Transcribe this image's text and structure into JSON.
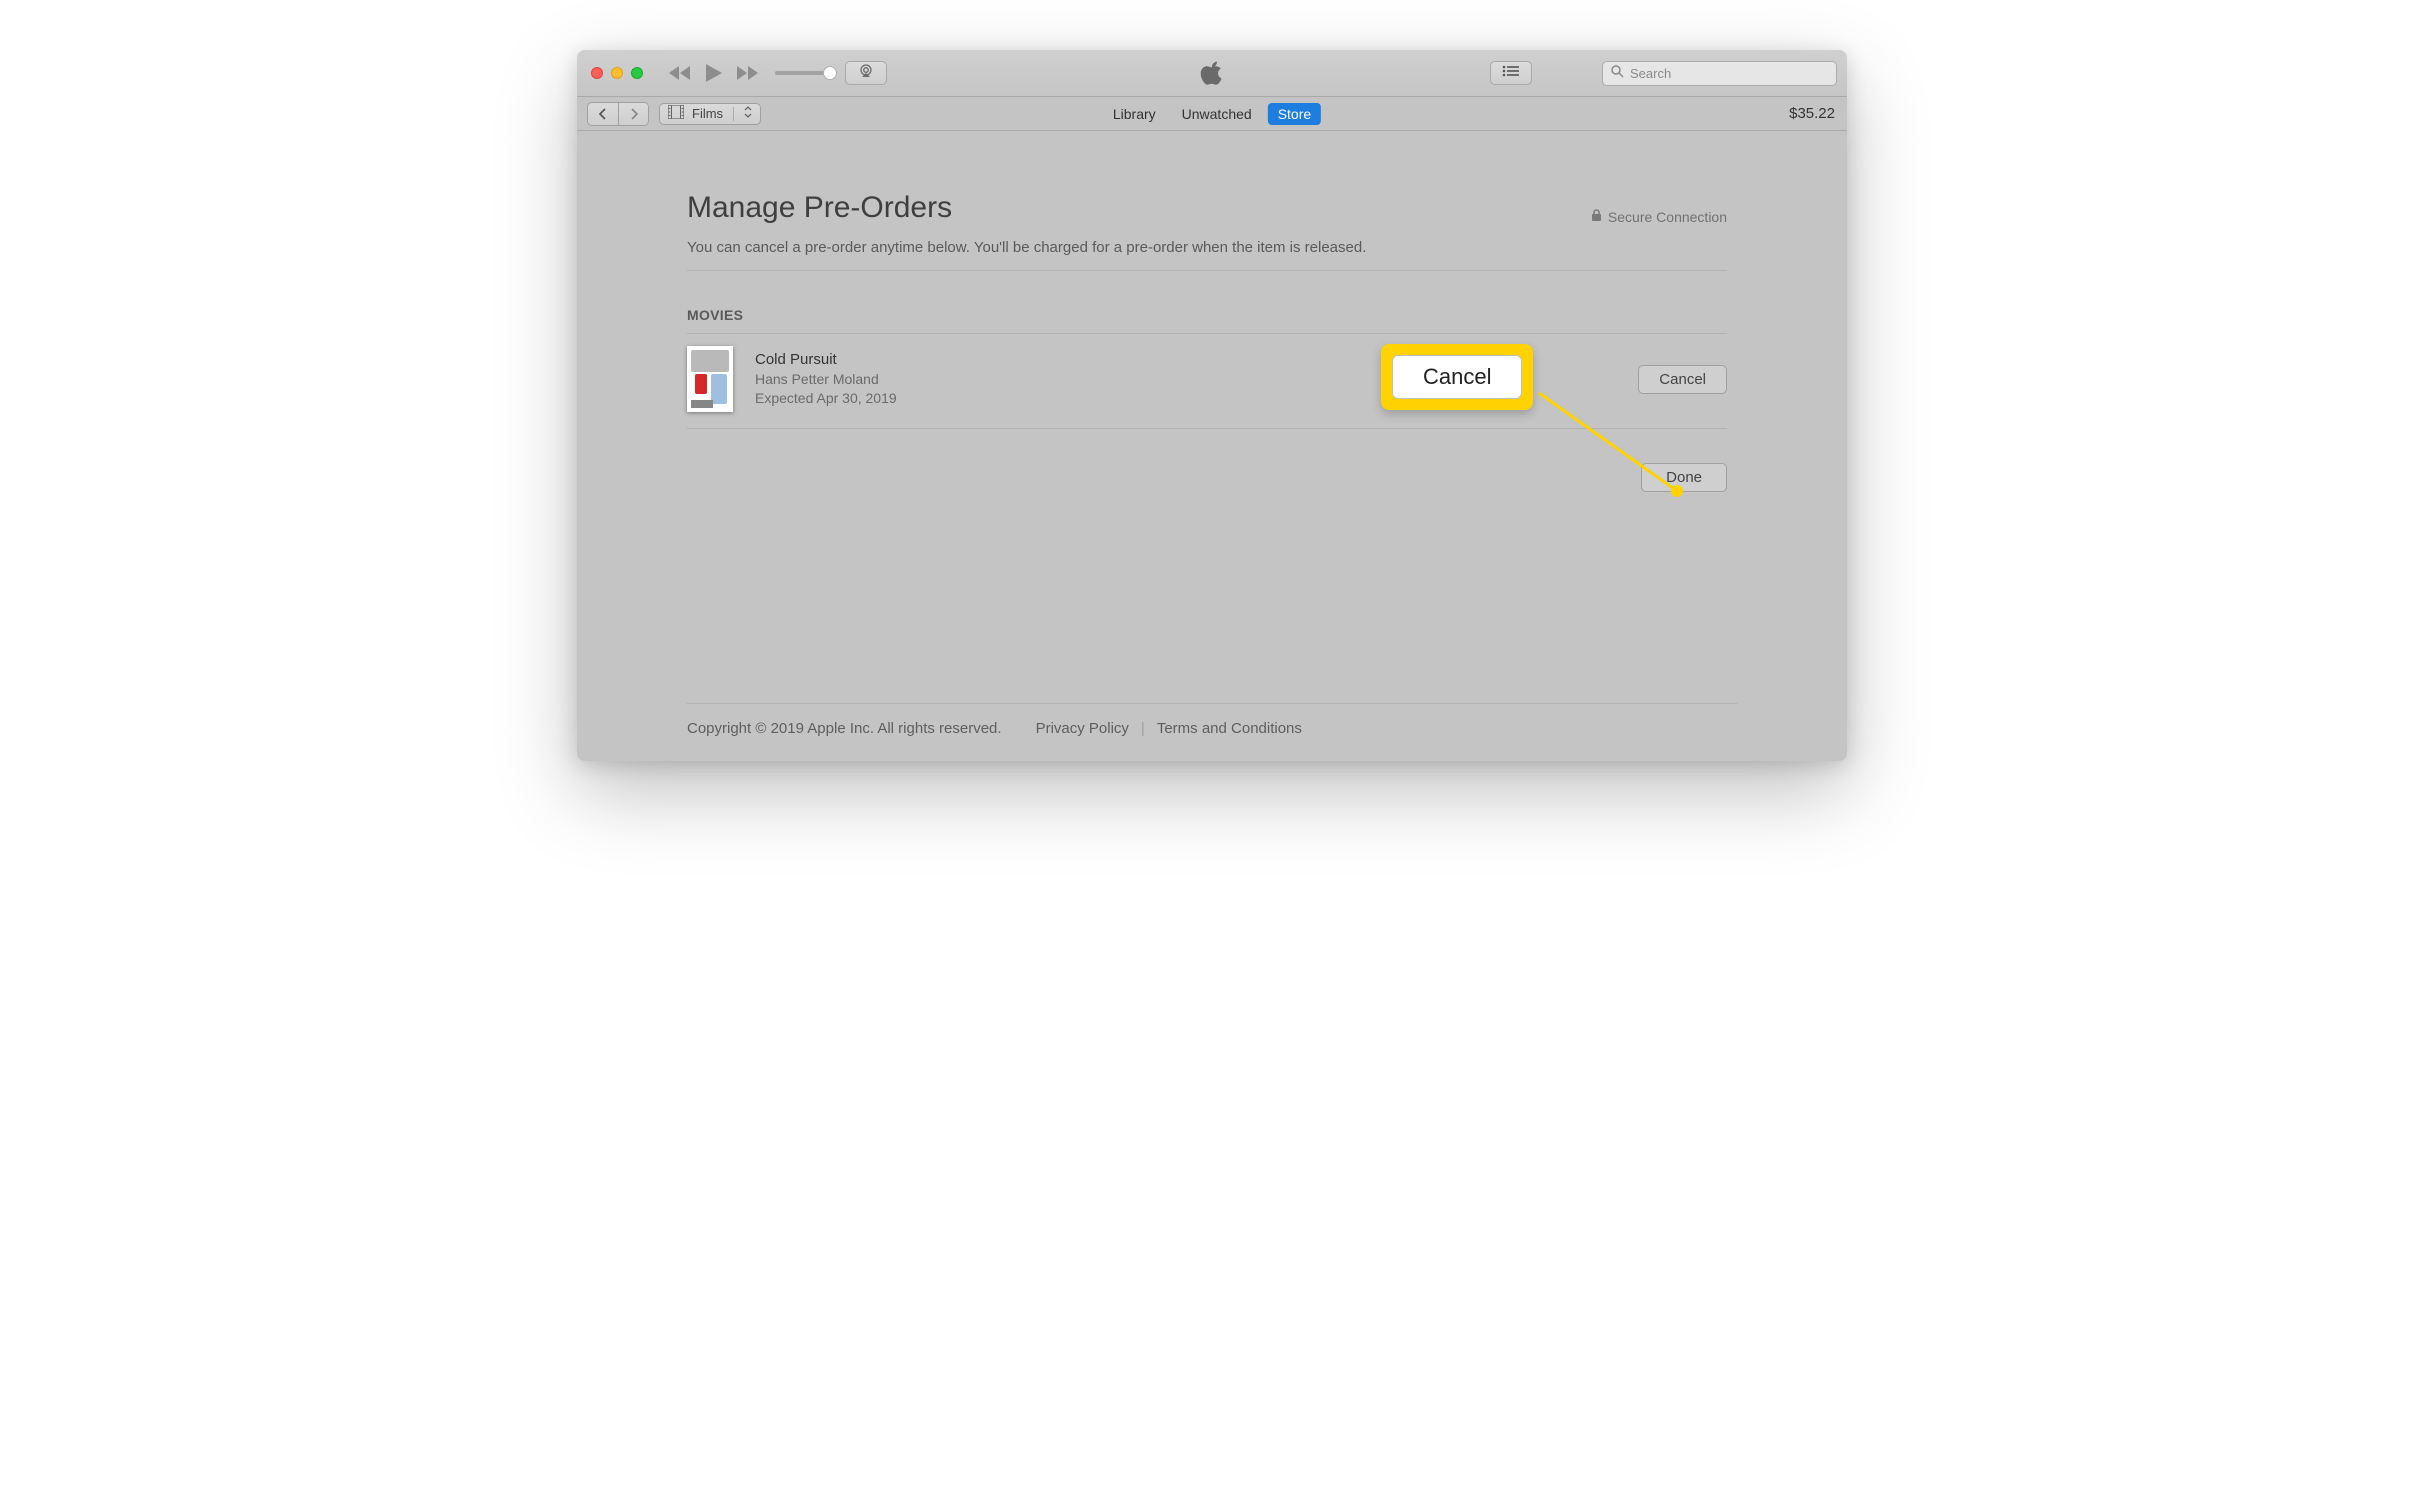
{
  "titlebar": {
    "search_placeholder": "Search"
  },
  "subbar": {
    "media_label": "Films",
    "tabs": {
      "library": "Library",
      "unwatched": "Unwatched",
      "store": "Store"
    },
    "balance": "$35.22"
  },
  "page": {
    "title": "Manage Pre-Orders",
    "subtitle": "You can cancel a pre-order anytime below. You'll be charged for a pre-order when the item is released.",
    "secure_label": "Secure Connection",
    "section_movies": "MOVIES",
    "item": {
      "title": "Cold Pursuit",
      "director": "Hans Petter Moland",
      "expected": "Expected Apr 30, 2019",
      "cancel_label": "Cancel"
    },
    "done_label": "Done"
  },
  "footer": {
    "copyright": "Copyright © 2019 Apple Inc. All rights reserved.",
    "privacy": "Privacy Policy",
    "terms": "Terms and Conditions"
  },
  "callout": {
    "label": "Cancel"
  }
}
